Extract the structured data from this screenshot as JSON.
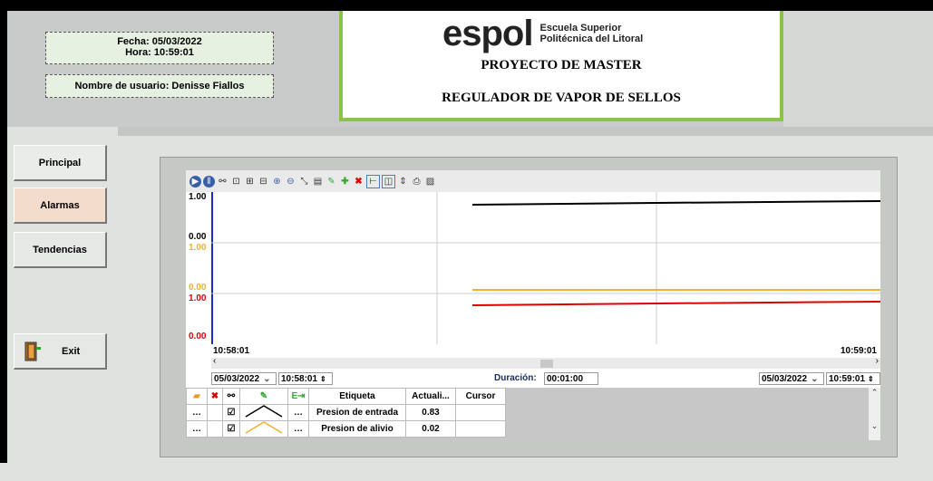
{
  "header": {
    "date_line": "Fecha: 05/03/2022",
    "time_line": "Hora: 10:59:01",
    "user_line": "Nombre de usuario: Denisse Fiallos",
    "logo_text": "espol",
    "logo_sub1": "Escuela Superior",
    "logo_sub2": "Politécnica del Litoral",
    "project_title": "PROYECTO DE MASTER",
    "system_title": "REGULADOR DE VAPOR DE SELLOS"
  },
  "nav": {
    "principal": "Principal",
    "alarmas": "Alarmas",
    "tendencias": "Tendencias",
    "exit": "Exit"
  },
  "trend": {
    "y_labels": [
      {
        "text": "1.00",
        "color": "#000000"
      },
      {
        "text": "0.00",
        "color": "#000000"
      },
      {
        "text": "1.00",
        "color": "#f0b030"
      },
      {
        "text": "0.00",
        "color": "#f0b030"
      },
      {
        "text": "1.00",
        "color": "#e00000"
      },
      {
        "text": "0.00",
        "color": "#e00000"
      }
    ],
    "time_start": "10:58:01",
    "time_end": "10:59:01",
    "start_date": "05/03/2022",
    "start_time": "10:58:01",
    "end_date": "05/03/2022",
    "end_time": "10:59:01",
    "duration_label": "Duración:",
    "duration_value": "00:01:00"
  },
  "legend": {
    "col_label": "Etiqueta",
    "col_actual": "Actuali...",
    "col_cursor": "Cursor",
    "rows": [
      {
        "label": "Presion de entrada",
        "value": "0.83",
        "color": "#000000"
      },
      {
        "label": "Presion de alivio",
        "value": "0.02",
        "color": "#f0b030"
      }
    ]
  },
  "colors": {
    "accent_border": "#8bc34a",
    "alarm_button": "#f4dccd",
    "series_black": "#000000",
    "series_orange": "#f0b030",
    "series_red": "#e00000"
  }
}
